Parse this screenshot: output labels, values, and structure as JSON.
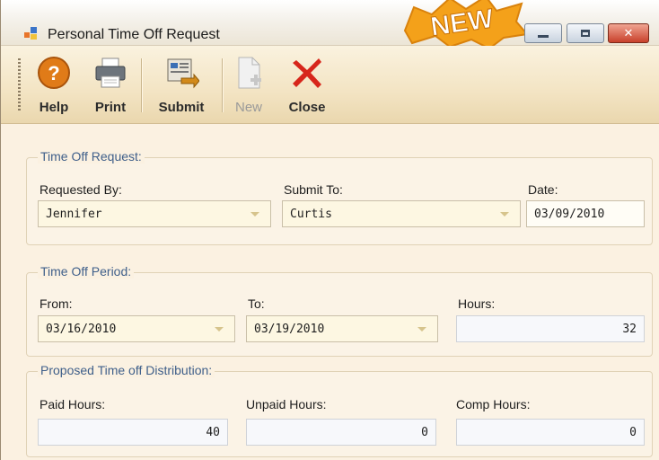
{
  "window": {
    "title": "Personal Time Off Request",
    "badge": "NEW",
    "controls": {
      "minimize_icon": "minimize-icon",
      "maximize_icon": "maximize-icon",
      "close_glyph": "✕"
    }
  },
  "toolbar": {
    "help_label": "Help",
    "print_label": "Print",
    "submit_label": "Submit",
    "new_label": "New",
    "close_label": "Close"
  },
  "request": {
    "title": "Time Off Request:",
    "requested_by_label": "Requested By:",
    "requested_by_value": "Jennifer",
    "submit_to_label": "Submit To:",
    "submit_to_value": "Curtis",
    "date_label": "Date:",
    "date_value": "03/09/2010"
  },
  "period": {
    "title": "Time Off Period:",
    "from_label": "From:",
    "from_value": "03/16/2010",
    "to_label": "To:",
    "to_value": "03/19/2010",
    "hours_label": "Hours:",
    "hours_value": "32"
  },
  "distribution": {
    "title": "Proposed Time off Distribution:",
    "paid_label": "Paid Hours:",
    "paid_value": "40",
    "unpaid_label": "Unpaid Hours:",
    "unpaid_value": "0",
    "comp_label": "Comp Hours:",
    "comp_value": "0"
  },
  "colors": {
    "window_bg": "#fbf1e1",
    "group_title": "#3f5f8a",
    "close_red": "#d7261b",
    "badge_orange": "#f4a11a"
  }
}
